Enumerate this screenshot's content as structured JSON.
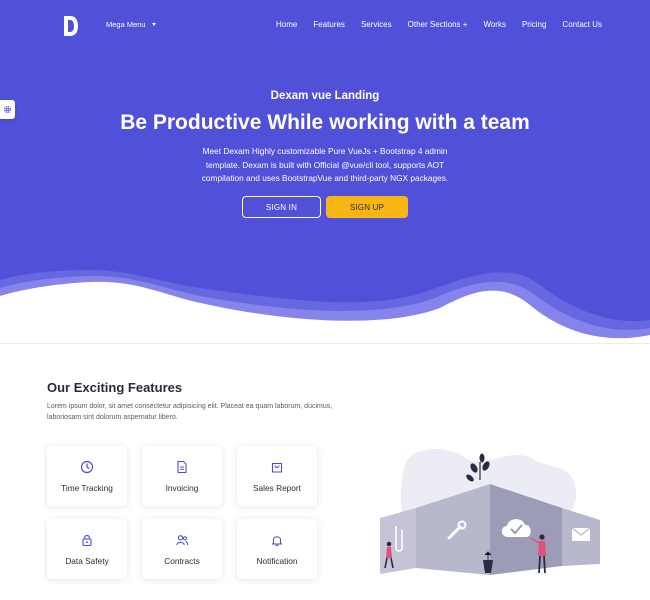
{
  "colors": {
    "hero": "#5050d8",
    "wave_mid": "#6767e0",
    "wave_light": "#8484ea",
    "accent": "#f7b614",
    "icon": "#4b4bd4"
  },
  "nav": {
    "logo": "D",
    "mega_menu": "Mega Menu",
    "items": [
      "Home",
      "Features",
      "Services",
      "Other Sections +",
      "Works",
      "Pricing",
      "Contact Us"
    ]
  },
  "settings_icon": "gear-icon",
  "hero": {
    "subtitle": "Dexam vue Landing",
    "title": "Be Productive While working with a team",
    "description": "Meet Dexam Highly customizable Pure VueJs + Bootstrap 4 admin template. Dexam is built with Official @vue/cli tool, supports AOT compilation and uses BootstrapVue and third-party NGX packages.",
    "signin": "SIGN IN",
    "signup": "SIGN UP"
  },
  "features": {
    "title": "Our Exciting Features",
    "description": "Lorem ipsum dolor, sit amet consectetur adipisicing elit. Placeat ea quam laborum, ducimus, laboriosam sint dolorum aspernatur libero.",
    "cards": [
      {
        "label": "Time Tracking",
        "icon": "clock-icon"
      },
      {
        "label": "Invoicing",
        "icon": "invoice-icon"
      },
      {
        "label": "Sales Report",
        "icon": "bag-icon"
      },
      {
        "label": "Data Safety",
        "icon": "lock-icon"
      },
      {
        "label": "Contracts",
        "icon": "users-icon"
      },
      {
        "label": "Notification",
        "icon": "bell-icon"
      }
    ]
  }
}
